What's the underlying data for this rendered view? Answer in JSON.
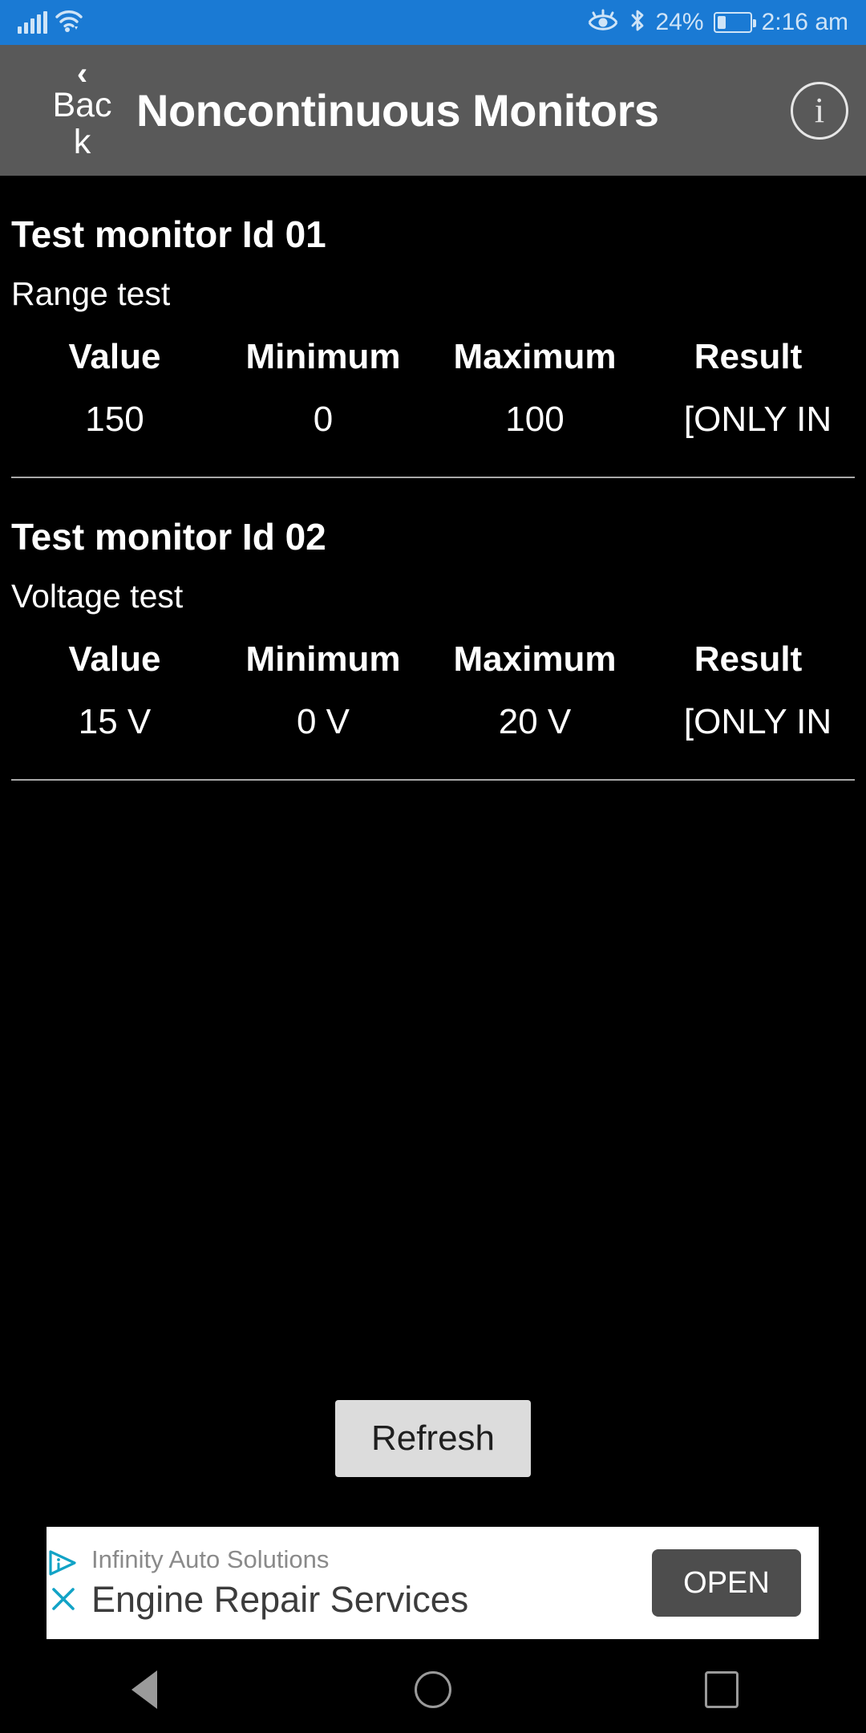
{
  "status_bar": {
    "background": "#1a7ad4",
    "signal_icon": "cellular-signal-icon",
    "wifi_icon": "wifi-icon",
    "eye_icon": "eye-comfort-icon",
    "bluetooth_icon": "bluetooth-icon",
    "battery_percent": "24%",
    "battery_level": 24,
    "battery_icon": "battery-icon",
    "time": "2:16 am"
  },
  "app_bar": {
    "background": "#595959",
    "back_chevron": "‹",
    "back_label": "Back",
    "title": "Noncontinuous Monitors",
    "info_label": "i"
  },
  "table_headers": [
    "Value",
    "Minimum",
    "Maximum",
    "Result"
  ],
  "monitors": [
    {
      "title": "Test monitor Id 01",
      "subtitle": "Range test",
      "value": "150",
      "minimum": "0",
      "maximum": "100",
      "result": "[ONLY IN"
    },
    {
      "title": "Test monitor Id 02",
      "subtitle": "Voltage test",
      "value": "15 V",
      "minimum": "0 V",
      "maximum": "20 V",
      "result": "[ONLY IN"
    }
  ],
  "refresh_button": {
    "label": "Refresh",
    "background": "#dcdcdc",
    "text_color": "#1f1f1f"
  },
  "ad": {
    "advertiser": "Infinity Auto Solutions",
    "headline": "Engine Repair Services",
    "cta_label": "OPEN",
    "adchoices_icon": "adchoices-icon",
    "close_icon": "close-icon",
    "accent": "#12a3c6"
  },
  "nav_bar": {
    "back_icon": "nav-back-triangle-icon",
    "home_icon": "nav-home-circle-icon",
    "recents_icon": "nav-recents-square-icon"
  }
}
